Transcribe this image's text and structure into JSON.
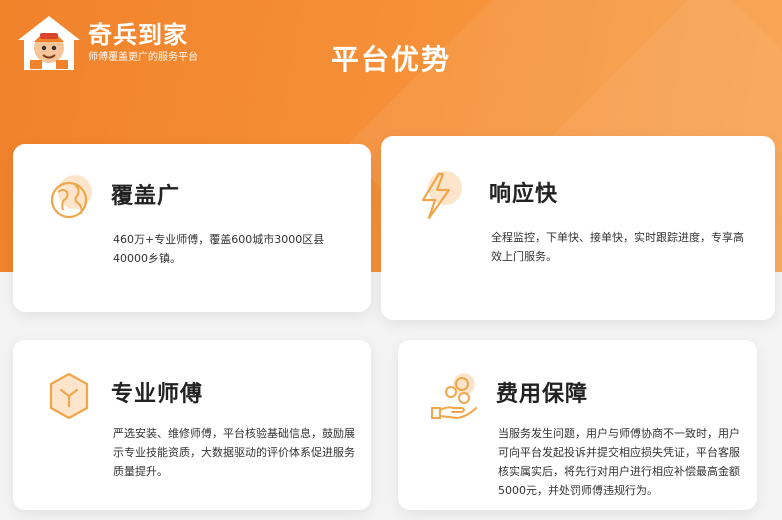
{
  "brand": {
    "name": "奇兵到家",
    "slogan": "师傅覆盖更广的服务平台"
  },
  "page": {
    "title": "平台优势"
  },
  "colors": {
    "accent": "#f0822a",
    "icon_stroke": "#f0a64a",
    "icon_fill": "#fde5cc"
  },
  "cards": [
    {
      "icon": "globe-icon",
      "title": "覆盖广",
      "desc": "460万+专业师傅，覆盖600城市3000区县40000乡镇。"
    },
    {
      "icon": "lightning-icon",
      "title": "响应快",
      "desc": "全程监控，下单快、接单快，实时跟踪进度，专享高效上门服务。"
    },
    {
      "icon": "cube-icon",
      "title": "专业师傅",
      "desc": "严选安装、维修师傅，平台核验基础信息，鼓励展示专业技能资质，大数据驱动的评价体系促进服务质量提升。"
    },
    {
      "icon": "coins-hand-icon",
      "title": "费用保障",
      "desc": "当服务发生问题，用户与师傅协商不一致时，用户可向平台发起投诉并提交相应损失凭证，平台客服核实属实后，将先行对用户进行相应补偿最高金额5000元，并处罚师傅违规行为。"
    }
  ]
}
